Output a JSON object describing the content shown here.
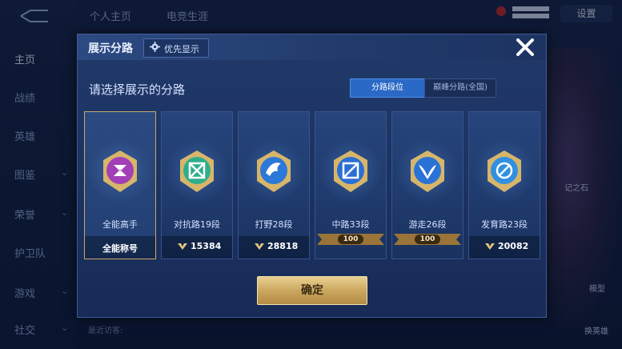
{
  "background": {
    "nav_items": [
      {
        "label": "主页",
        "active": true
      },
      {
        "label": "战绩"
      },
      {
        "label": "英雄"
      },
      {
        "label": "图鉴"
      },
      {
        "label": "荣誉"
      },
      {
        "label": "护卫队"
      },
      {
        "label": "游戏"
      },
      {
        "label": "社交"
      }
    ],
    "top_tabs": [
      "个人主页",
      "电竞生涯"
    ],
    "settings_label": "设置",
    "right_text_1": "记之石",
    "right_text_2": "模型",
    "right_text_3": "换英雄",
    "visitor_label": "最近访客:"
  },
  "modal": {
    "title": "展示分路",
    "priority_label": "优先显示",
    "prompt": "请选择展示的分路",
    "segments": [
      "分路段位",
      "巅峰分路(全国)"
    ],
    "confirm_label": "确定",
    "cards": [
      {
        "name": "全能高手",
        "foot": "全能称号",
        "selected": true,
        "color": "#a23fb6"
      },
      {
        "name": "对抗路19段",
        "foot_num": "15384",
        "color": "#2fae8c"
      },
      {
        "name": "打野28段",
        "foot_num": "28818",
        "color": "#2b78d8"
      },
      {
        "name": "中路33段",
        "banner": "100",
        "color": "#2a6fd4"
      },
      {
        "name": "游走26段",
        "banner": "100",
        "color": "#2a72d6"
      },
      {
        "name": "发育路23段",
        "foot_num": "20082",
        "color": "#3190e0"
      }
    ]
  }
}
